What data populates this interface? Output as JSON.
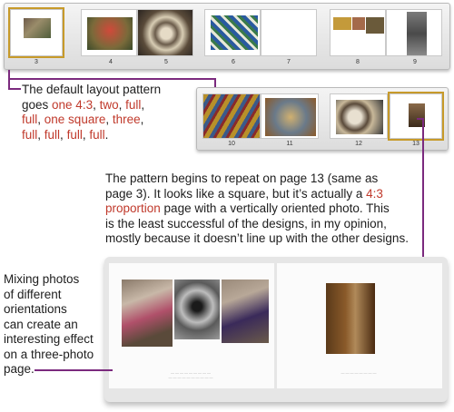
{
  "top_strip": {
    "page_numbers": [
      "3",
      "4",
      "5",
      "6",
      "7",
      "8",
      "9"
    ]
  },
  "second_strip": {
    "page_numbers": [
      "10",
      "11",
      "12",
      "13"
    ]
  },
  "callout_layout": {
    "line1": "The default layout pattern",
    "line2_prefix": "goes ",
    "p_one43": "one 4:3",
    "sep1": ", ",
    "p_two": "two",
    "sep2": ", ",
    "p_full1": "full",
    "sep3": ",",
    "p_full2": "full",
    "sep4": ", ",
    "p_onesquare": "one square",
    "sep5": ", ",
    "p_three": "three",
    "sep6": ",",
    "p_full3": "full",
    "sep7": ", ",
    "p_full4": "full",
    "sep8": ", ",
    "p_full5": "full",
    "sep9": ", ",
    "p_full6": "full",
    "end": "."
  },
  "callout_repeat": {
    "line1": "The pattern begins to repeat on page 13 (same as",
    "line2": "page 3). It looks like a square, but it’s actually a ",
    "accent1": "4:3",
    "accent2": "proportion",
    "line3_rest": " page with a vertically oriented photo. This",
    "line4": "is the least successful of the designs, in my opinion,",
    "line5": "mostly because it doesn’t line up with the other designs."
  },
  "callout_mixing": {
    "lines": [
      "Mixing photos",
      "of different",
      "orientations",
      "can create an",
      "interesting effect",
      "on a three-photo",
      "page."
    ]
  },
  "colors": {
    "accent": "#c0392b",
    "leader": "#7b2a7e"
  }
}
